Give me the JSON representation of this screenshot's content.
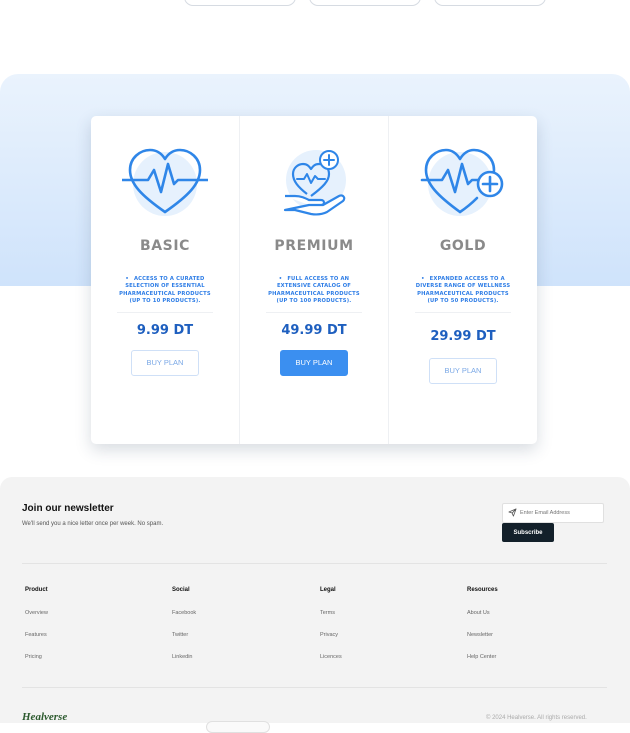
{
  "colors": {
    "accent": "#3b8ff0",
    "price": "#1e5fbf",
    "feature": "#2e7de6",
    "footer_bg": "#f3f3f3",
    "subscribe_bg": "#13202a",
    "brand": "#2c5a2e"
  },
  "plans": [
    {
      "icon": "heart-pulse-icon",
      "name": "BASIC",
      "feature": "Access to a curated selection of essential pharmaceutical products (up to 10 products).",
      "price": "9.99 DT",
      "button": "BUY PLAN",
      "highlighted": false
    },
    {
      "icon": "hand-heart-icon",
      "name": "PREMIUM",
      "feature": "Full access to an extensive catalog of pharmaceutical products (up to 100 products).",
      "price": "49.99 DT",
      "button": "BUY PLAN",
      "highlighted": true
    },
    {
      "icon": "heart-plus-icon",
      "name": "GOLD",
      "feature": "Expanded access to a diverse range of wellness pharmaceutical products (up to 50 products).",
      "price": "29.99 DT",
      "button": "BUY PLAN",
      "highlighted": false
    }
  ],
  "newsletter": {
    "title": "Join our newsletter",
    "subtitle": "We'll send you a nice letter once per week. No spam.",
    "email_icon": "send-icon",
    "email_placeholder": "Enter Email Address",
    "subscribe_label": "Subscribe"
  },
  "footer_columns": [
    {
      "title": "Product",
      "links": [
        "Overview",
        "Features",
        "Pricing"
      ]
    },
    {
      "title": "Social",
      "links": [
        "Facebook",
        "Twitter",
        "Linkedin"
      ]
    },
    {
      "title": "Legal",
      "links": [
        "Terms",
        "Privacy",
        "Licences"
      ]
    },
    {
      "title": "Resources",
      "links": [
        "About Us",
        "Newsletter",
        "Help Center"
      ]
    }
  ],
  "brand": "Healverse",
  "copyright": "© 2024 Healverse. All rights reserved."
}
